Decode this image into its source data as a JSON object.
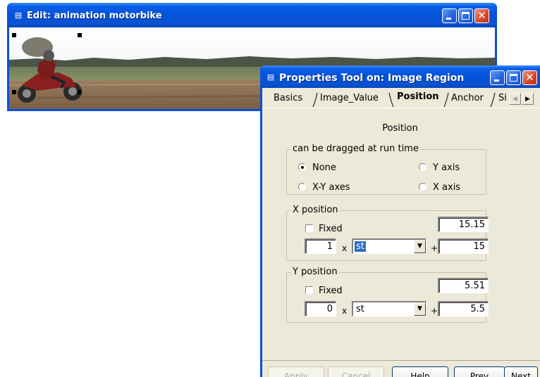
{
  "edit_window": {
    "title": "Edit: animation motorbike"
  },
  "properties_window": {
    "title": "Properties Tool on: Image Region",
    "tabs": [
      {
        "label": "Basics",
        "active": false
      },
      {
        "label": "Image_Value",
        "active": false
      },
      {
        "label": "Position",
        "active": true
      },
      {
        "label": "Anchor",
        "active": false
      },
      {
        "label": "Si",
        "active": false
      }
    ],
    "section_title": "Position",
    "drag_group": {
      "caption": "can be dragged at run time",
      "options": [
        {
          "label": "None",
          "selected": true
        },
        {
          "label": "Y axis",
          "selected": false
        },
        {
          "label": "X-Y axes",
          "selected": false
        },
        {
          "label": "X axis",
          "selected": false
        }
      ]
    },
    "x_position": {
      "caption": "X position",
      "fixed_label": "Fixed",
      "fixed_checked": false,
      "value": "15.15",
      "multiplier": "1",
      "times": "x",
      "unit": "st",
      "plus": "+",
      "offset": "15"
    },
    "y_position": {
      "caption": "Y position",
      "fixed_label": "Fixed",
      "fixed_checked": false,
      "value": "5.51",
      "multiplier": "0",
      "times": "x",
      "unit": "st",
      "plus": "+",
      "offset": "5.5"
    },
    "buttons": {
      "apply": "Apply",
      "cancel": "Cancel",
      "help": "Help",
      "prev": "Prev",
      "next": "Next"
    }
  },
  "colors": {
    "titlebar": "#0453d9",
    "dialog_face": "#ece9d8",
    "close_button": "#d9442b",
    "selection": "#316ac5"
  }
}
